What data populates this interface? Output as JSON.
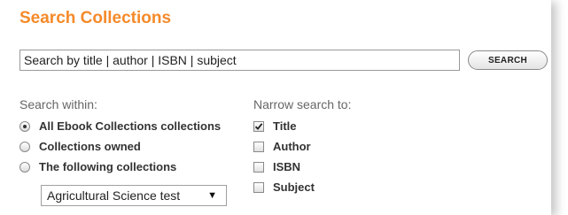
{
  "title": "Search Collections",
  "search": {
    "value": "Search by title | author | ISBN | subject",
    "button_label": "SEARCH"
  },
  "search_within": {
    "heading": "Search within:",
    "options": [
      {
        "label": "All Ebook Collections collections",
        "selected": true
      },
      {
        "label": "Collections owned",
        "selected": false
      },
      {
        "label": "The following collections",
        "selected": false
      }
    ],
    "collection_select": {
      "value": "Agricultural Science test"
    }
  },
  "narrow": {
    "heading": "Narrow search to:",
    "options": [
      {
        "label": "Title",
        "checked": true
      },
      {
        "label": "Author",
        "checked": false
      },
      {
        "label": "ISBN",
        "checked": false
      },
      {
        "label": "Subject",
        "checked": false
      }
    ]
  },
  "colors": {
    "title": "#f58a2a",
    "heading": "#666666"
  }
}
